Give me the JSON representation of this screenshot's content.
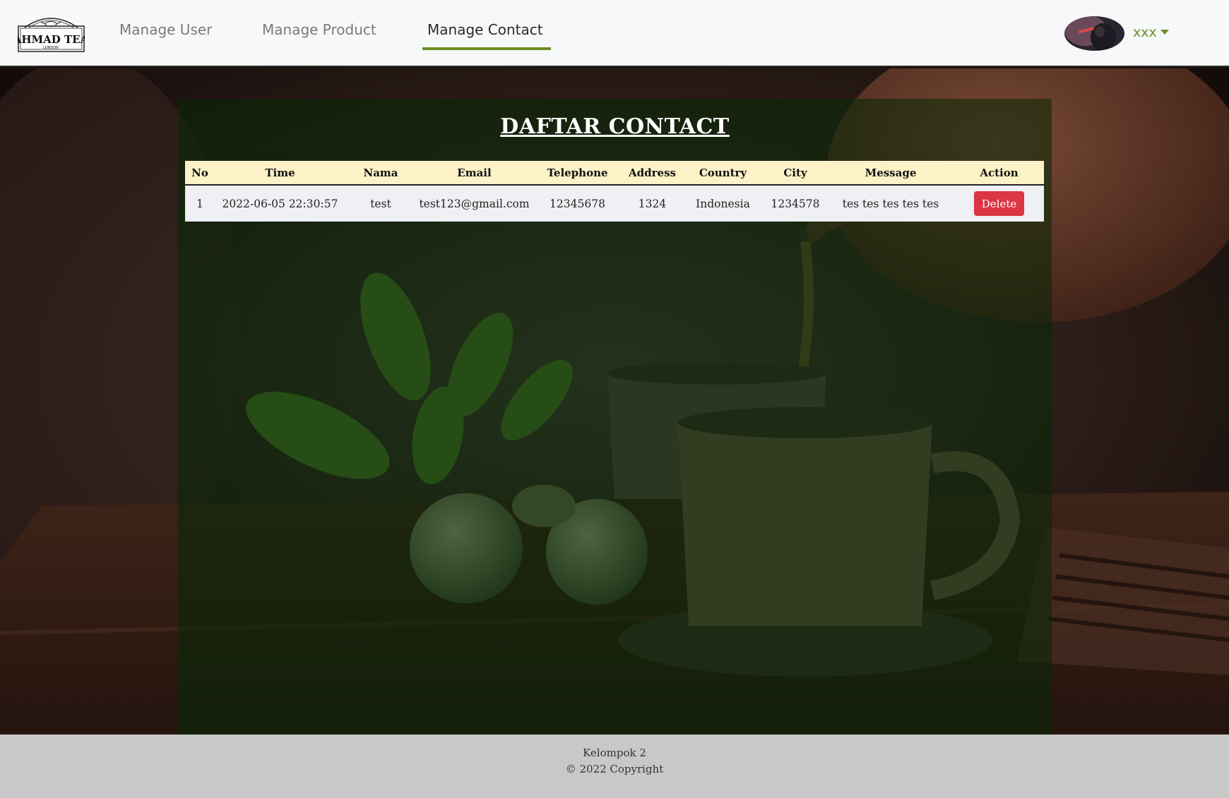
{
  "header": {
    "logo_text": "AHMAD TEA",
    "logo_subtext": "LONDON",
    "nav": [
      {
        "label": "Manage User"
      },
      {
        "label": "Manage Product"
      },
      {
        "label": "Manage Contact",
        "active": true
      }
    ],
    "user": {
      "name": "xxx"
    }
  },
  "main": {
    "title": "DAFTAR CONTACT",
    "table": {
      "columns": [
        "No",
        "Time",
        "Nama",
        "Email",
        "Telephone",
        "Address",
        "Country",
        "City",
        "Message",
        "Action"
      ],
      "rows": [
        {
          "no": "1",
          "time": "2022-06-05 22:30:57",
          "nama": "test",
          "email": "test123@gmail.com",
          "telephone": "12345678",
          "address": "1324",
          "country": "Indonesia",
          "city": "1234578",
          "message": "tes tes tes tes tes",
          "action": "Delete"
        }
      ]
    }
  },
  "footer": {
    "line1": "Kelompok 2",
    "line2": "© 2022 Copyright"
  },
  "colors": {
    "accent": "#6b8e23",
    "delete": "#dc3545",
    "table_header": "#fdf1c8"
  }
}
